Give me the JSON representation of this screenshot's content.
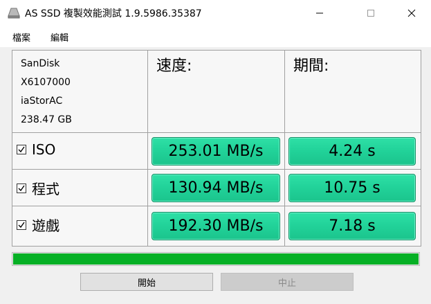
{
  "window": {
    "title": "AS SSD 複製效能測試 1.9.5986.35387",
    "icons": {
      "app": "drive-icon",
      "minimize": "minimize-icon",
      "maximize": "maximize-icon",
      "close": "close-icon"
    }
  },
  "menu": {
    "file": "檔案",
    "edit": "編輯"
  },
  "drive": {
    "name": "SanDisk",
    "model": "X6107000",
    "driver": "iaStorAC",
    "size": "238.47 GB"
  },
  "columns": {
    "speed": "速度:",
    "duration": "期間:"
  },
  "tests": [
    {
      "label": "ISO",
      "checked": true,
      "speed": "253.01 MB/s",
      "duration": "4.24 s"
    },
    {
      "label": "程式",
      "checked": true,
      "speed": "130.94 MB/s",
      "duration": "10.75 s"
    },
    {
      "label": "遊戲",
      "checked": true,
      "speed": "192.30 MB/s",
      "duration": "7.18 s"
    }
  ],
  "progress": {
    "percent": 100,
    "color": "#06b025"
  },
  "colors": {
    "result_green": "#22d39a"
  },
  "buttons": {
    "start": "開始",
    "stop": "中止"
  }
}
